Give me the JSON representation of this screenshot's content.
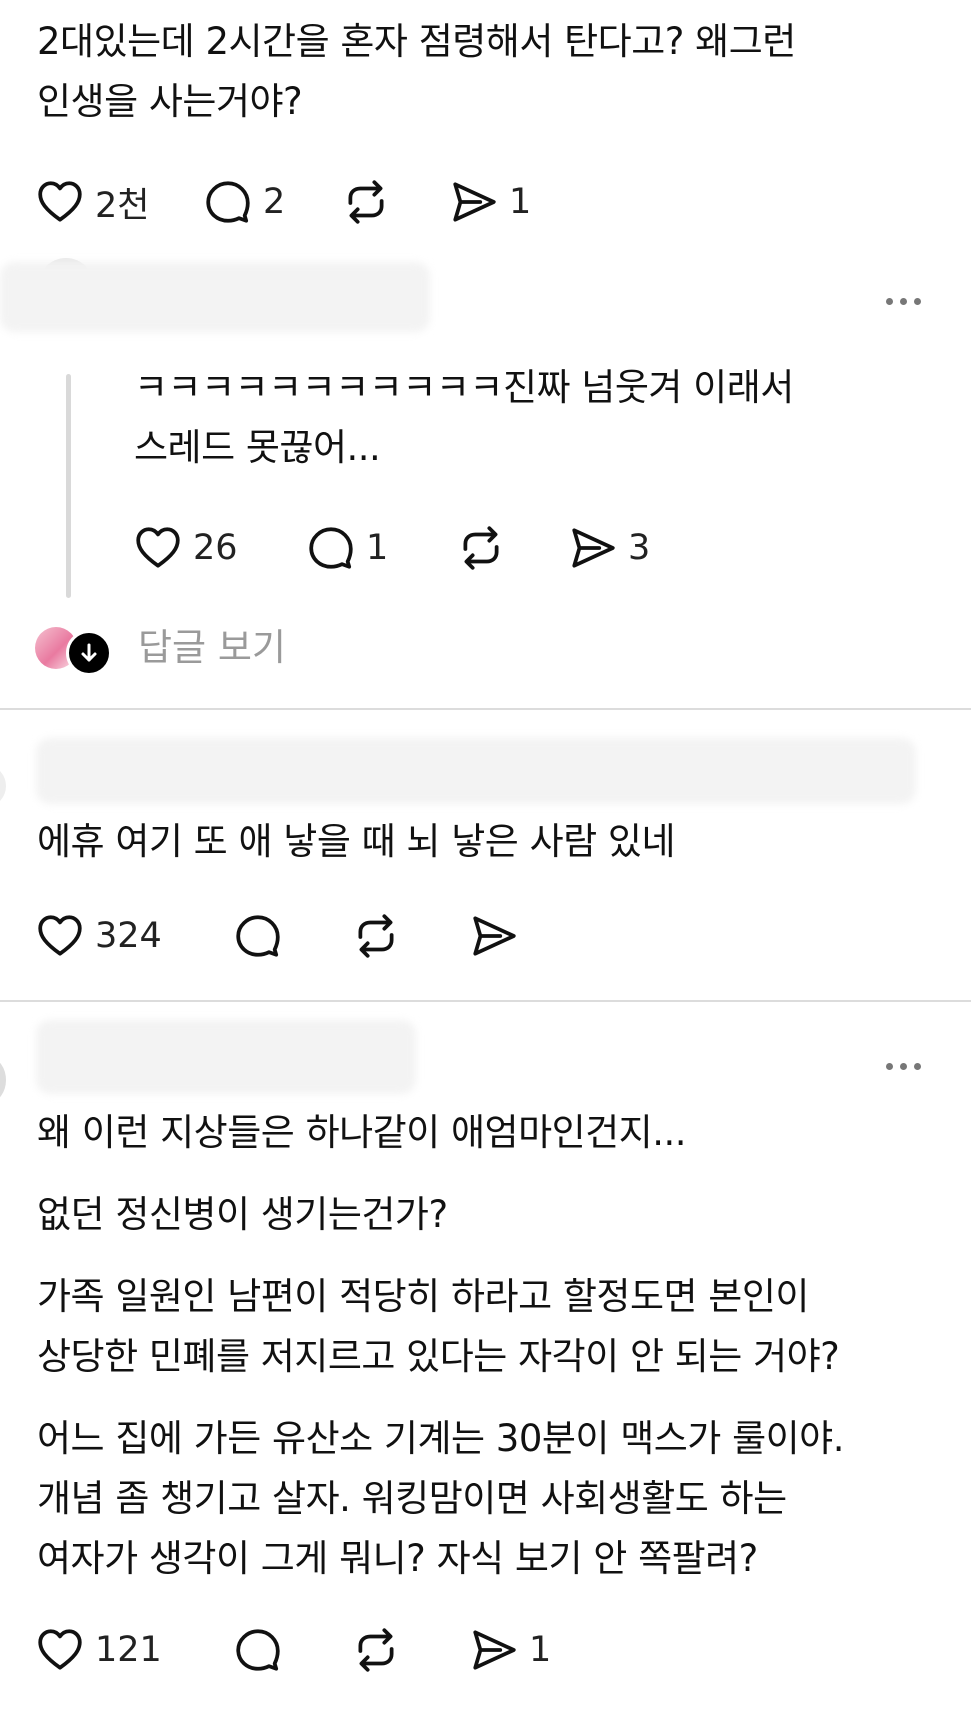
{
  "post1": {
    "lines": [
      "2대있는데 2시간을 혼자 점령해서 탄다고? 왜그런",
      "인생을 사는거야?"
    ],
    "likes": "2천",
    "replies": "2",
    "shares": "1"
  },
  "reply1": {
    "lines": [
      "ㅋㅋㅋㅋㅋㅋㅋㅋㅋㅋㅋ진짜 넘웃겨 이래서",
      "스레드 못끊어..."
    ],
    "likes": "26",
    "replies": "1",
    "shares": "3",
    "view_replies": "답글 보기"
  },
  "post2": {
    "lines": [
      "에휴 여기 또 애 낳을 때 뇌 낳은 사람 있네"
    ],
    "likes": "324"
  },
  "post3": {
    "paragraphs": [
      "왜 이런 지상들은 하나같이 애엄마인건지...",
      "없던 정신병이 생기는건가?",
      "가족 일원인 남편이 적당히 하라고 할정도면 본인이",
      "상당한 민폐를 저지르고 있다는 자각이 안 되는 거야?",
      "어느 집에 가든 유산소 기계는 30분이 맥스가 룰이야.",
      "개념 좀 챙기고 살자. 워킹맘이면 사회생활도 하는",
      "여자가 생각이 그게 뭐니? 자식 보기 안 쪽팔려?"
    ],
    "likes": "121",
    "shares": "1"
  },
  "icons": [
    "heart-icon",
    "comment-icon",
    "repost-icon",
    "send-icon",
    "more-icon",
    "arrow-down-icon"
  ],
  "colors": {
    "text": "#111111",
    "muted": "#999999",
    "divider": "#dcdcdc"
  }
}
